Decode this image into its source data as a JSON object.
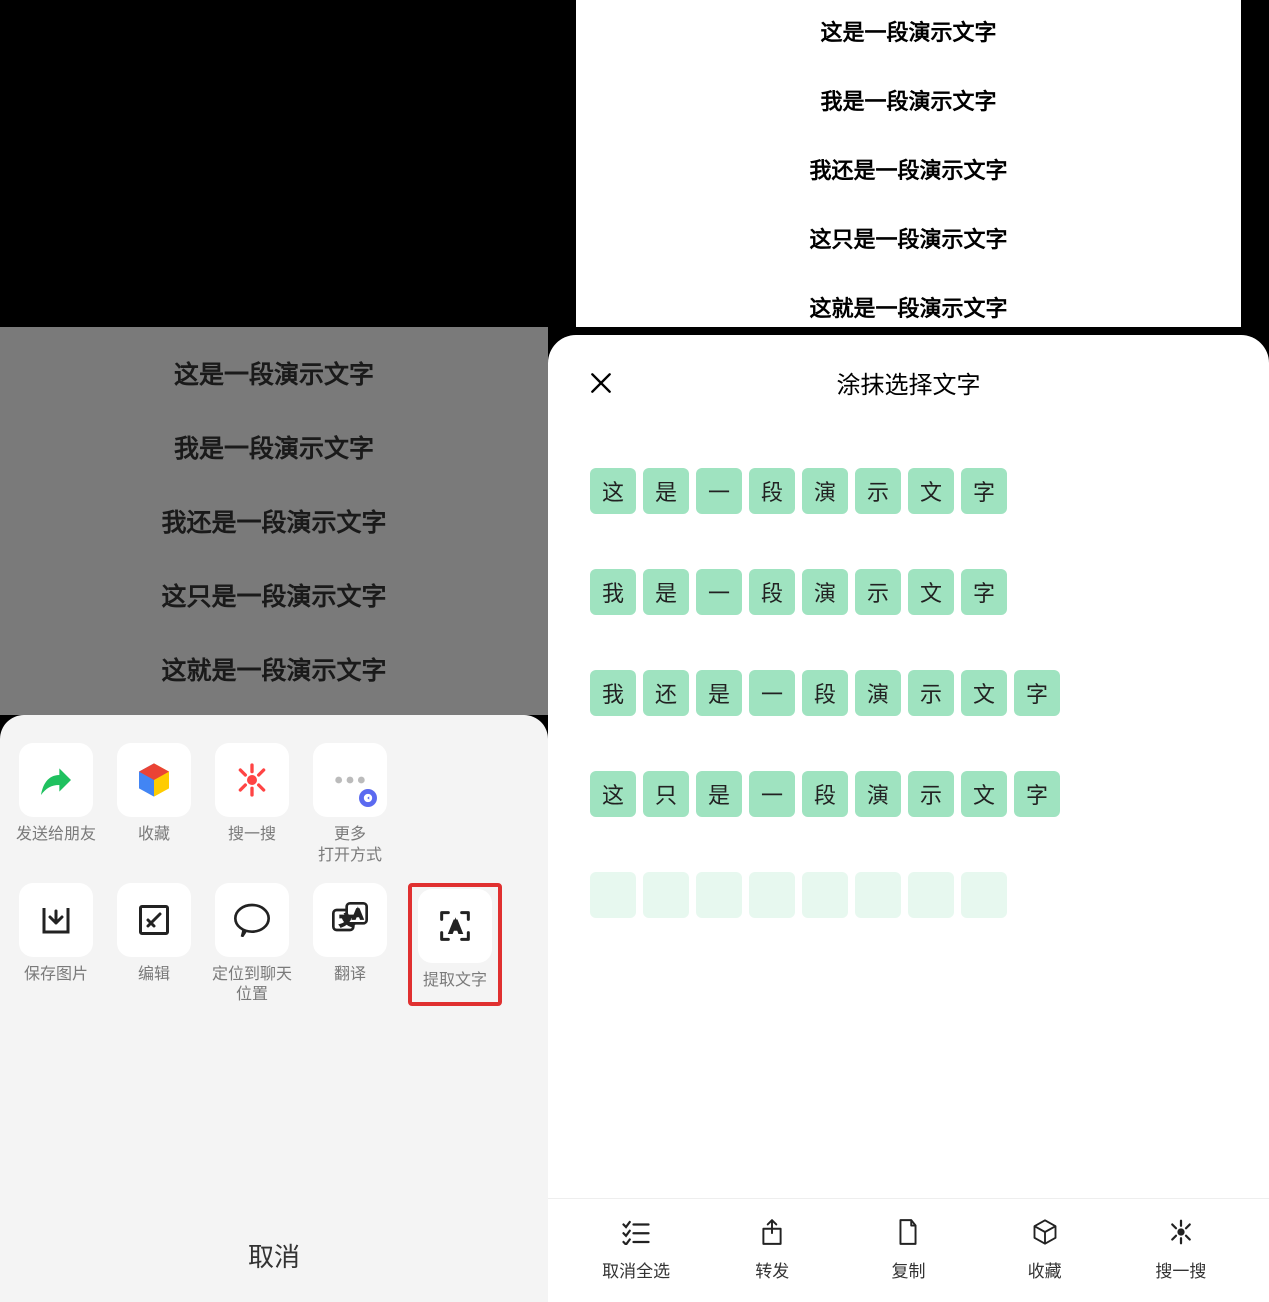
{
  "left": {
    "demo_lines": [
      "这是一段演示文字",
      "我是一段演示文字",
      "我还是一段演示文字",
      "这只是一段演示文字",
      "这就是一段演示文字"
    ],
    "actions_row1": [
      {
        "name": "share-to-friend",
        "label": "发送给朋友"
      },
      {
        "name": "favorite",
        "label": "收藏"
      },
      {
        "name": "search",
        "label": "搜一搜"
      },
      {
        "name": "more-open",
        "label": "更多\n打开方式"
      }
    ],
    "actions_row2": [
      {
        "name": "save-image",
        "label": "保存图片"
      },
      {
        "name": "edit",
        "label": "编辑"
      },
      {
        "name": "locate-chat",
        "label": "定位到聊天\n位置"
      },
      {
        "name": "translate",
        "label": "翻译"
      },
      {
        "name": "extract-text",
        "label": "提取文字"
      }
    ],
    "cancel": "取消"
  },
  "right": {
    "demo_lines": [
      "这是一段演示文字",
      "我是一段演示文字",
      "我还是一段演示文字",
      "这只是一段演示文字",
      "这就是一段演示文字"
    ],
    "title": "涂抹选择文字",
    "char_rows": [
      [
        "这",
        "是",
        "一",
        "段",
        "演",
        "示",
        "文",
        "字"
      ],
      [
        "我",
        "是",
        "一",
        "段",
        "演",
        "示",
        "文",
        "字"
      ],
      [
        "我",
        "还",
        "是",
        "一",
        "段",
        "演",
        "示",
        "文",
        "字"
      ],
      [
        "这",
        "只",
        "是",
        "一",
        "段",
        "演",
        "示",
        "文",
        "字"
      ]
    ],
    "bottom_actions": [
      {
        "name": "deselect-all",
        "label": "取消全选"
      },
      {
        "name": "forward",
        "label": "转发"
      },
      {
        "name": "copy",
        "label": "复制"
      },
      {
        "name": "favorite",
        "label": "收藏"
      },
      {
        "name": "search",
        "label": "搜一搜"
      }
    ]
  }
}
